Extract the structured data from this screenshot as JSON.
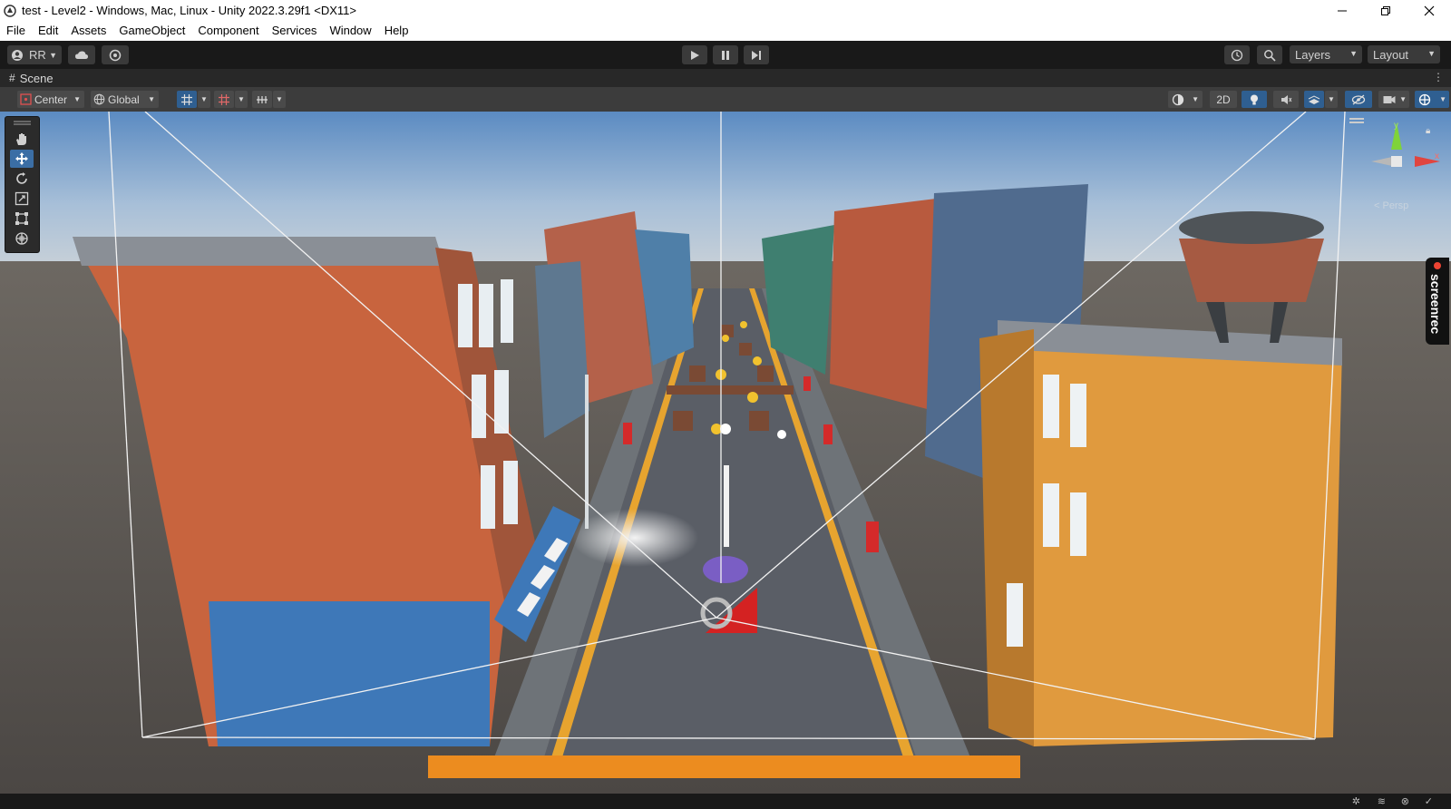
{
  "window": {
    "title": "test - Level2 - Windows, Mac, Linux - Unity 2022.3.29f1 <DX11>",
    "controls": [
      "minimize",
      "maximize",
      "close"
    ]
  },
  "menubar": {
    "items": [
      "File",
      "Edit",
      "Assets",
      "GameObject",
      "Component",
      "Services",
      "Window",
      "Help"
    ]
  },
  "toolbar": {
    "account_label": "RR",
    "layers_label": "Layers",
    "layout_label": "Layout",
    "icons": [
      "account-icon",
      "cloud-icon",
      "collab-icon",
      "play-icon",
      "pause-icon",
      "step-icon",
      "history-icon",
      "search-icon"
    ]
  },
  "scene_tab": {
    "label": "Scene",
    "icon": "grid-hash-icon"
  },
  "scene_toolbar": {
    "pivot_label": "Center",
    "space_label": "Global",
    "mode_2d_label": "2D",
    "icons": [
      "grid-snap-icon",
      "grid-visibility-icon",
      "increment-snap-icon",
      "draw-mode-icon",
      "lighting-icon",
      "audio-icon",
      "effects-icon",
      "hidden-objects-icon",
      "camera-icon",
      "gizmos-icon"
    ]
  },
  "tools_palette": {
    "tools": [
      "hand-tool",
      "move-tool",
      "rotate-tool",
      "scale-tool",
      "rect-tool",
      "transform-tool"
    ],
    "active": "move-tool"
  },
  "scene_gizmo": {
    "axis_y": "y",
    "axis_x": "x",
    "projection_label": "< Persp"
  },
  "overlay": {
    "screenrec_label": "screenrec"
  },
  "colors": {
    "sky_top": "#5f8fc4",
    "ground": "#4e4a46",
    "building_orange": "#c8643e",
    "building_blue": "#3e78b8",
    "road": "#5a5e66",
    "accent_active": "#3b6ea5"
  }
}
